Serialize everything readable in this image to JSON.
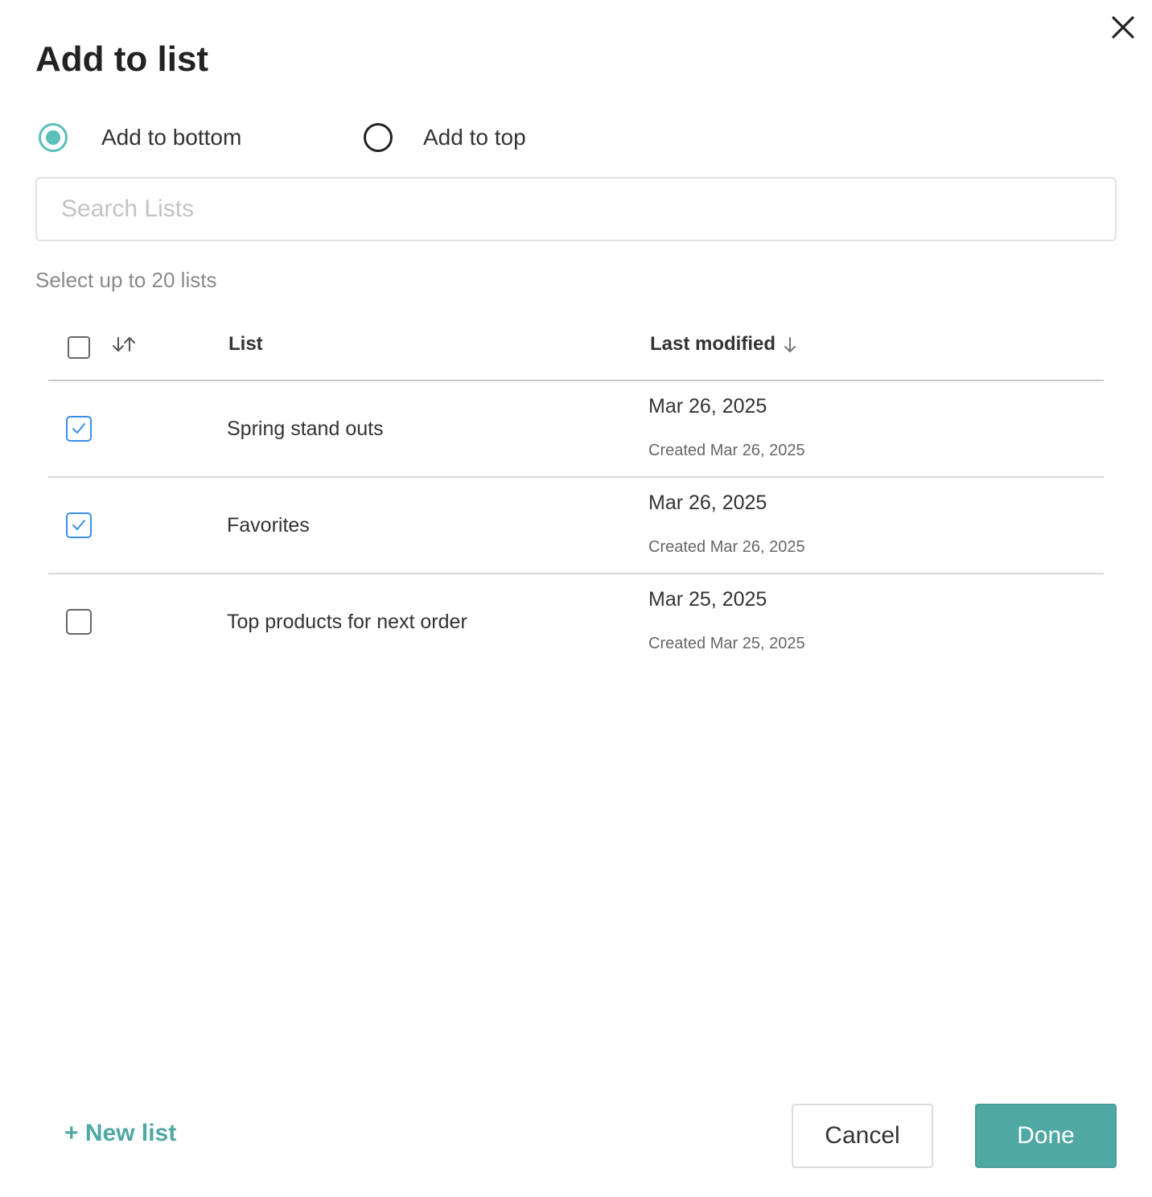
{
  "dialog": {
    "title": "Add to list"
  },
  "placement": {
    "options": [
      {
        "label": "Add to bottom",
        "selected": true
      },
      {
        "label": "Add to top",
        "selected": false
      }
    ]
  },
  "search": {
    "placeholder": "Search Lists",
    "value": ""
  },
  "hint": "Select up to 20 lists",
  "table": {
    "columns": {
      "list": "List",
      "last_modified": "Last modified"
    },
    "select_all_checked": false,
    "rows": [
      {
        "name": "Spring stand outs",
        "modified": "Mar 26, 2025",
        "created": "Created Mar 26, 2025",
        "checked": true
      },
      {
        "name": "Favorites",
        "modified": "Mar 26, 2025",
        "created": "Created Mar 26, 2025",
        "checked": true
      },
      {
        "name": "Top products for next order",
        "modified": "Mar 25, 2025",
        "created": "Created Mar 25, 2025",
        "checked": false
      }
    ]
  },
  "footer": {
    "new_list": "+ New list",
    "cancel": "Cancel",
    "done": "Done"
  },
  "colors": {
    "accent": "#4fa8a3",
    "radio_selected": "#5bbfba",
    "checkbox_checked": "#3b8ee8"
  },
  "icons": {
    "close": "close-icon",
    "sort": "sort-arrows-icon",
    "sort_desc": "arrow-down-icon",
    "check": "checkmark-icon"
  }
}
